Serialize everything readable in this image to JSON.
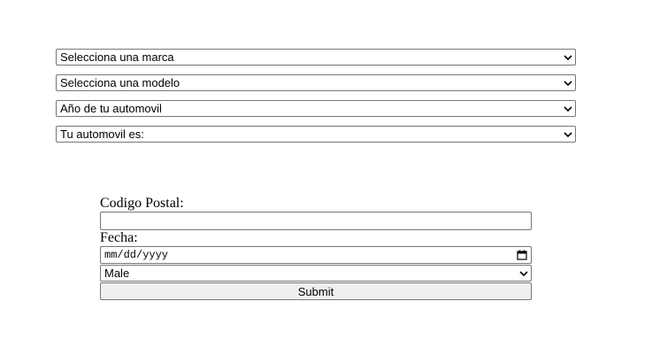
{
  "vehicle_selects": {
    "brand": "Selecciona una marca",
    "model": "Selecciona una modelo",
    "year": "Año de tu automovil",
    "car": "Tu automovil es:"
  },
  "form": {
    "postal_code_label": "Codigo Postal:",
    "postal_code_value": "",
    "date_label": "Fecha:",
    "date_placeholder": "mm/dd/yyyy",
    "gender_value": "Male",
    "submit_label": "Submit"
  },
  "icons": {
    "dropdown": "chevron-down-icon",
    "calendar": "calendar-icon"
  }
}
